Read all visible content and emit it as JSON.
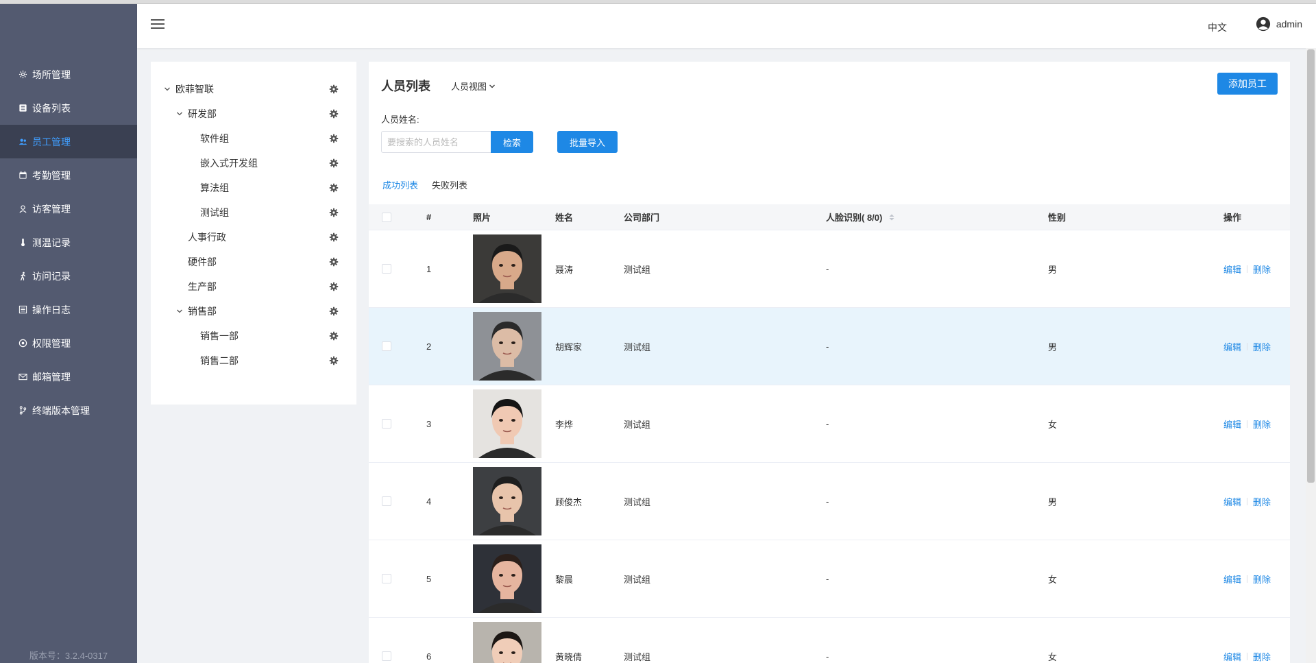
{
  "sidebar": {
    "items": [
      {
        "label": "场所管理",
        "icon": "gear-icon"
      },
      {
        "label": "设备列表",
        "icon": "list-icon"
      },
      {
        "label": "员工管理",
        "icon": "users-icon"
      },
      {
        "label": "考勤管理",
        "icon": "calendar-icon"
      },
      {
        "label": "访客管理",
        "icon": "visitor-icon"
      },
      {
        "label": "测温记录",
        "icon": "thermometer-icon"
      },
      {
        "label": "访问记录",
        "icon": "walking-icon"
      },
      {
        "label": "操作日志",
        "icon": "log-icon"
      },
      {
        "label": "权限管理",
        "icon": "shield-icon"
      },
      {
        "label": "邮箱管理",
        "icon": "mail-icon"
      },
      {
        "label": "终端版本管理",
        "icon": "branch-icon"
      }
    ],
    "active_index": 2,
    "version": "版本号：3.2.4-0317"
  },
  "header": {
    "lang": "中文",
    "user": "admin"
  },
  "tree": {
    "nodes": [
      {
        "label": "欧菲智联",
        "level": 0,
        "expanded": true
      },
      {
        "label": "研发部",
        "level": 1,
        "expanded": true
      },
      {
        "label": "软件组",
        "level": 2
      },
      {
        "label": "嵌入式开发组",
        "level": 2
      },
      {
        "label": "算法组",
        "level": 2
      },
      {
        "label": "测试组",
        "level": 2
      },
      {
        "label": "人事行政",
        "level": 1
      },
      {
        "label": "硬件部",
        "level": 1
      },
      {
        "label": "生产部",
        "level": 1
      },
      {
        "label": "销售部",
        "level": 1,
        "expanded": true
      },
      {
        "label": "销售一部",
        "level": 2
      },
      {
        "label": "销售二部",
        "level": 2
      }
    ]
  },
  "main": {
    "title": "人员列表",
    "view_dropdown": "人员视图",
    "add_button": "添加员工",
    "search_label": "人员姓名:",
    "search_placeholder": "要搜索的人员姓名",
    "search_button": "检索",
    "import_button": "批量导入",
    "tabs": [
      "成功列表",
      "失败列表"
    ],
    "active_tab": 0
  },
  "table": {
    "headers": {
      "num": "#",
      "photo": "照片",
      "name": "姓名",
      "dept": "公司部门",
      "face": "人脸识别( 8/0)",
      "gender": "性别",
      "ops": "操作"
    },
    "edit_label": "编辑",
    "delete_label": "删除",
    "highlighted_row": 1,
    "rows": [
      {
        "num": "1",
        "name": "聂涛",
        "dept": "测试组",
        "face": "-",
        "gender": "男",
        "bg": "#3b3a38",
        "skin": "#d8a98a",
        "hair": "#1a1a1a"
      },
      {
        "num": "2",
        "name": "胡辉家",
        "dept": "测试组",
        "face": "-",
        "gender": "男",
        "bg": "#8e9196",
        "skin": "#dcbca6",
        "hair": "#2a2a2a"
      },
      {
        "num": "3",
        "name": "李烨",
        "dept": "测试组",
        "face": "-",
        "gender": "女",
        "bg": "#e5e3e0",
        "skin": "#f0c9b3",
        "hair": "#151515"
      },
      {
        "num": "4",
        "name": "顾俊杰",
        "dept": "测试组",
        "face": "-",
        "gender": "男",
        "bg": "#3d3f42",
        "skin": "#e8c4ab",
        "hair": "#1e1e1e"
      },
      {
        "num": "5",
        "name": "黎晨",
        "dept": "测试组",
        "face": "-",
        "gender": "女",
        "bg": "#2e3138",
        "skin": "#e6b59f",
        "hair": "#2b1f1a"
      },
      {
        "num": "6",
        "name": "黄晓倩",
        "dept": "测试组",
        "face": "-",
        "gender": "女",
        "bg": "#b8b4ad",
        "skin": "#f0cdb8",
        "hair": "#1c1714"
      }
    ]
  }
}
